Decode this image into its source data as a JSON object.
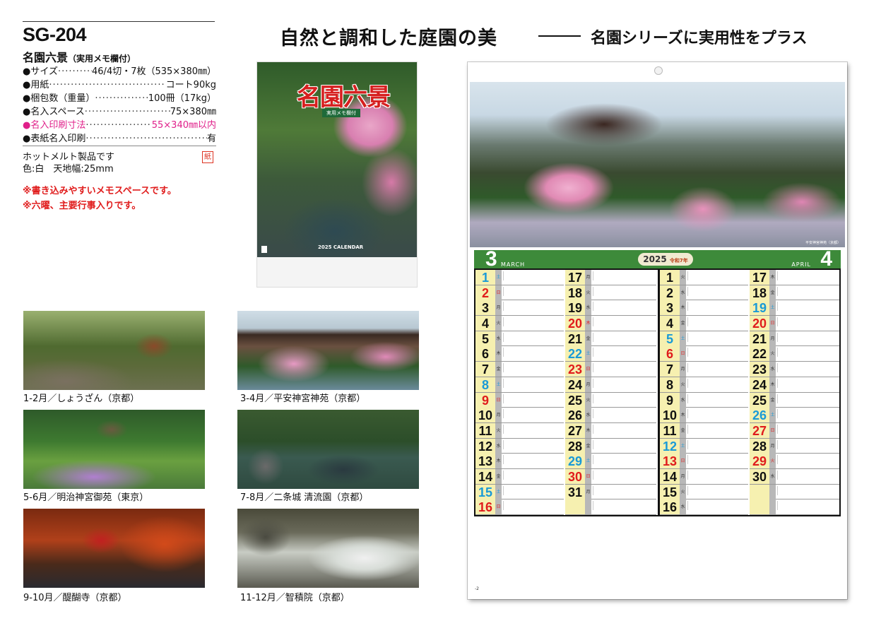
{
  "product": {
    "code": "SG-204",
    "name": "名園六景",
    "name_note": "（実用メモ欄付）"
  },
  "specs": [
    {
      "label": "●サイズ",
      "value": "46/4切・7枚（535×380㎜）",
      "pink": false
    },
    {
      "label": "●用紙",
      "value": "コート90kg",
      "pink": false
    },
    {
      "label": "●梱包数（重量）",
      "value": "100冊（17kg）",
      "pink": false
    },
    {
      "label": "●名入スペース",
      "value": "75×380㎜",
      "pink": false
    },
    {
      "label": "●名入印刷寸法",
      "value": "55×340㎜以内",
      "pink": true
    },
    {
      "label": "●表紙名入印刷",
      "value": "有",
      "pink": false
    }
  ],
  "notes": {
    "line1": "ホットメルト製品です",
    "line2": "色:白　天地幅:25mm",
    "paper_badge": "紙",
    "red1": "※書き込みやすいメモスペースです。",
    "red2": "※六曜、主要行事入りです。"
  },
  "cover": {
    "title": "名園六景",
    "subtitle": "実用メモ欄付",
    "calendar_label": "2025 CALENDAR"
  },
  "headline": {
    "main": "自然と調和した庭園の美",
    "sub": "名園シリーズに実用性をプラス"
  },
  "thumbnails": [
    {
      "caption": "1-2月／しょうざん（京都）"
    },
    {
      "caption": "3-4月／平安神宮神苑（京都）"
    },
    {
      "caption": "5-6月／明治神宮御苑（東京）"
    },
    {
      "caption": "7-8月／二条城 清流園（京都）"
    },
    {
      "caption": "9-10月／醍醐寺（京都）"
    },
    {
      "caption": "11-12月／智積院（京都）"
    }
  ],
  "calendar": {
    "photo_caption": "平安神宮神苑（京都）",
    "month_left": "3",
    "month_left_en": "MARCH",
    "month_right": "4",
    "month_right_en": "APRIL",
    "year": "2025",
    "year_jp": "令和7年",
    "page_no": "-2",
    "columns": [
      {
        "days": [
          {
            "d": "1",
            "c": "blue",
            "w": "土"
          },
          {
            "d": "2",
            "c": "red",
            "w": "日"
          },
          {
            "d": "3",
            "c": "",
            "w": "月"
          },
          {
            "d": "4",
            "c": "",
            "w": "火"
          },
          {
            "d": "5",
            "c": "",
            "w": "水"
          },
          {
            "d": "6",
            "c": "",
            "w": "木"
          },
          {
            "d": "7",
            "c": "",
            "w": "金"
          },
          {
            "d": "8",
            "c": "blue",
            "w": "土"
          },
          {
            "d": "9",
            "c": "red",
            "w": "日"
          },
          {
            "d": "10",
            "c": "",
            "w": "月"
          },
          {
            "d": "11",
            "c": "",
            "w": "火"
          },
          {
            "d": "12",
            "c": "",
            "w": "水"
          },
          {
            "d": "13",
            "c": "",
            "w": "木"
          },
          {
            "d": "14",
            "c": "",
            "w": "金"
          },
          {
            "d": "15",
            "c": "blue",
            "w": "土"
          },
          {
            "d": "16",
            "c": "red",
            "w": "日"
          }
        ]
      },
      {
        "days": [
          {
            "d": "17",
            "c": "",
            "w": "月"
          },
          {
            "d": "18",
            "c": "",
            "w": "火"
          },
          {
            "d": "19",
            "c": "",
            "w": "水"
          },
          {
            "d": "20",
            "c": "red",
            "w": "木"
          },
          {
            "d": "21",
            "c": "",
            "w": "金"
          },
          {
            "d": "22",
            "c": "blue",
            "w": "土"
          },
          {
            "d": "23",
            "c": "red",
            "w": "日"
          },
          {
            "d": "24",
            "c": "",
            "w": "月"
          },
          {
            "d": "25",
            "c": "",
            "w": "火"
          },
          {
            "d": "26",
            "c": "",
            "w": "水"
          },
          {
            "d": "27",
            "c": "",
            "w": "木"
          },
          {
            "d": "28",
            "c": "",
            "w": "金"
          },
          {
            "d": "29",
            "c": "blue",
            "w": "土"
          },
          {
            "d": "30",
            "c": "red",
            "w": "日"
          },
          {
            "d": "31",
            "c": "",
            "w": "月"
          },
          {
            "d": "",
            "c": "",
            "w": ""
          }
        ]
      },
      {
        "days": [
          {
            "d": "1",
            "c": "",
            "w": "火"
          },
          {
            "d": "2",
            "c": "",
            "w": "水"
          },
          {
            "d": "3",
            "c": "",
            "w": "木"
          },
          {
            "d": "4",
            "c": "",
            "w": "金"
          },
          {
            "d": "5",
            "c": "blue",
            "w": "土"
          },
          {
            "d": "6",
            "c": "red",
            "w": "日"
          },
          {
            "d": "7",
            "c": "",
            "w": "月"
          },
          {
            "d": "8",
            "c": "",
            "w": "火"
          },
          {
            "d": "9",
            "c": "",
            "w": "水"
          },
          {
            "d": "10",
            "c": "",
            "w": "木"
          },
          {
            "d": "11",
            "c": "",
            "w": "金"
          },
          {
            "d": "12",
            "c": "blue",
            "w": "土"
          },
          {
            "d": "13",
            "c": "red",
            "w": "日"
          },
          {
            "d": "14",
            "c": "",
            "w": "月"
          },
          {
            "d": "15",
            "c": "",
            "w": "火"
          },
          {
            "d": "16",
            "c": "",
            "w": "水"
          }
        ]
      },
      {
        "days": [
          {
            "d": "17",
            "c": "",
            "w": "木"
          },
          {
            "d": "18",
            "c": "",
            "w": "金"
          },
          {
            "d": "19",
            "c": "blue",
            "w": "土"
          },
          {
            "d": "20",
            "c": "red",
            "w": "日"
          },
          {
            "d": "21",
            "c": "",
            "w": "月"
          },
          {
            "d": "22",
            "c": "",
            "w": "火"
          },
          {
            "d": "23",
            "c": "",
            "w": "水"
          },
          {
            "d": "24",
            "c": "",
            "w": "木"
          },
          {
            "d": "25",
            "c": "",
            "w": "金"
          },
          {
            "d": "26",
            "c": "blue",
            "w": "土"
          },
          {
            "d": "27",
            "c": "red",
            "w": "日"
          },
          {
            "d": "28",
            "c": "",
            "w": "月"
          },
          {
            "d": "29",
            "c": "red",
            "w": "火"
          },
          {
            "d": "30",
            "c": "",
            "w": "水"
          },
          {
            "d": "",
            "c": "",
            "w": ""
          },
          {
            "d": "",
            "c": "",
            "w": ""
          }
        ]
      }
    ]
  },
  "colors": {
    "green_bar": "#3d8a3a",
    "pink_accent": "#e0208a",
    "red_accent": "#e01c1c",
    "saturday_blue": "#1a9ad6"
  }
}
